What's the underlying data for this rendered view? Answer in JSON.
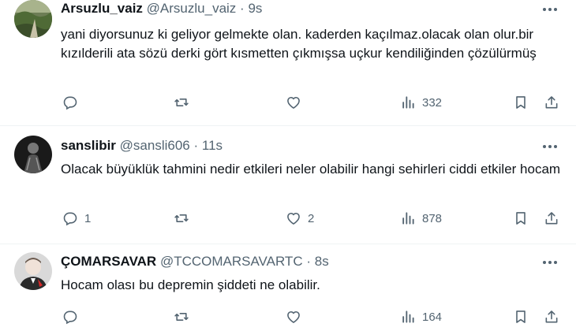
{
  "tweets": [
    {
      "name": "Arsuzlu_vaiz",
      "handle": "@Arsuzlu_vaiz",
      "separator": "·",
      "time": "9s",
      "text": "yani diyorsunuz ki geliyor gelmekte olan. kaderden kaçılmaz.olacak olan olur.bir kızılderili ata sözü derki gört kısmetten çıkmışsa uçkur kendiliğinden çözülürmüş",
      "replies": "",
      "retweets": "",
      "likes": "",
      "views": "332",
      "avatar_icon": "landscape-photo-avatar"
    },
    {
      "name": "sanslibir",
      "handle": "@sansli606",
      "separator": "·",
      "time": "11s",
      "text": "Olacak büyüklük tahmini nedir etkileri neler olabilir hangi sehirleri ciddi etkiler hocam",
      "replies": "1",
      "retweets": "",
      "likes": "2",
      "views": "878",
      "avatar_icon": "dark-figure-avatar"
    },
    {
      "name": "ÇOMARSAVAR",
      "handle": "@TCCOMARSAVARTC",
      "separator": "·",
      "time": "8s",
      "text": "Hocam olası bu depremin şiddeti ne olabilir.",
      "replies": "",
      "retweets": "",
      "likes": "",
      "views": "164",
      "avatar_icon": "portrait-avatar"
    }
  ],
  "icons": {
    "more": "more-dots-icon",
    "reply": "reply-icon",
    "retweet": "retweet-icon",
    "like": "like-icon",
    "views": "views-icon",
    "bookmark": "bookmark-icon",
    "share": "share-icon"
  },
  "colors": {
    "text": "#0f1419",
    "secondary": "#536471",
    "divider": "#eff3f4"
  }
}
